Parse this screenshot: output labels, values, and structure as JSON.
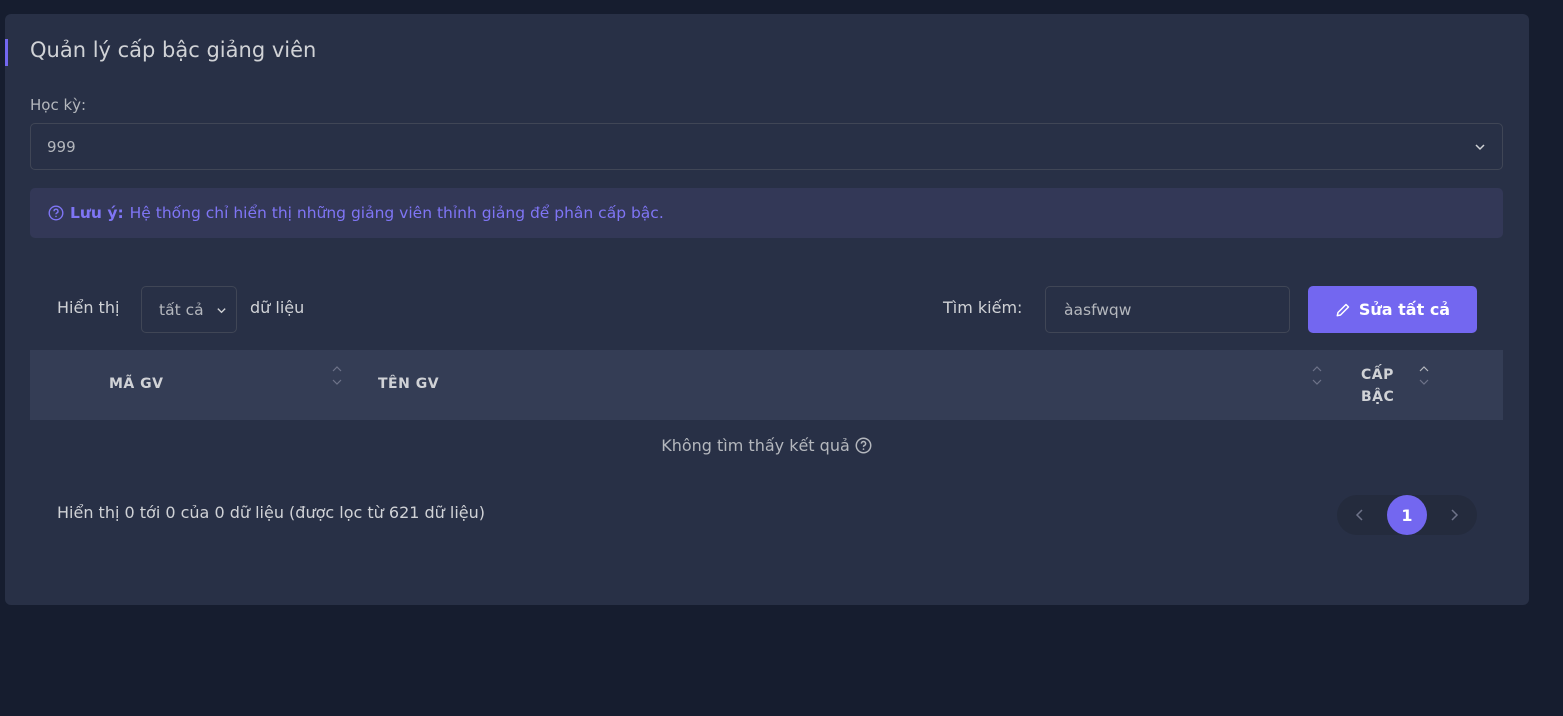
{
  "card": {
    "title": "Quản lý cấp bậc giảng viên"
  },
  "semester": {
    "label": "Học kỳ:",
    "value": "999"
  },
  "alert": {
    "icon": "help-circle-icon",
    "strong": "Lưu ý:",
    "text": "Hệ thống chỉ hiển thị những giảng viên thỉnh giảng để phân cấp bậc."
  },
  "length_control": {
    "prefix": "Hiển thị",
    "value": "tất cả",
    "suffix": "dữ liệu"
  },
  "search": {
    "label": "Tìm kiếm:",
    "value": "àasfwqw"
  },
  "edit_all_button": {
    "label": "Sửa tất cả",
    "icon": "pencil-icon"
  },
  "table": {
    "columns": [
      "MÃ GV",
      "TÊN GV",
      "CẤP BẬC"
    ],
    "empty_text": "Không tìm thấy kết quả",
    "empty_icon": "help-circle-icon"
  },
  "footer": {
    "info": "Hiển thị 0 tới 0 của 0 dữ liệu (được lọc từ 621 dữ liệu)"
  },
  "pagination": {
    "current_page": "1"
  },
  "colors": {
    "background": "#161d2f",
    "card": "#283046",
    "accent": "#7367f0",
    "table_header": "#343d55",
    "alert_bg": "#333857"
  }
}
